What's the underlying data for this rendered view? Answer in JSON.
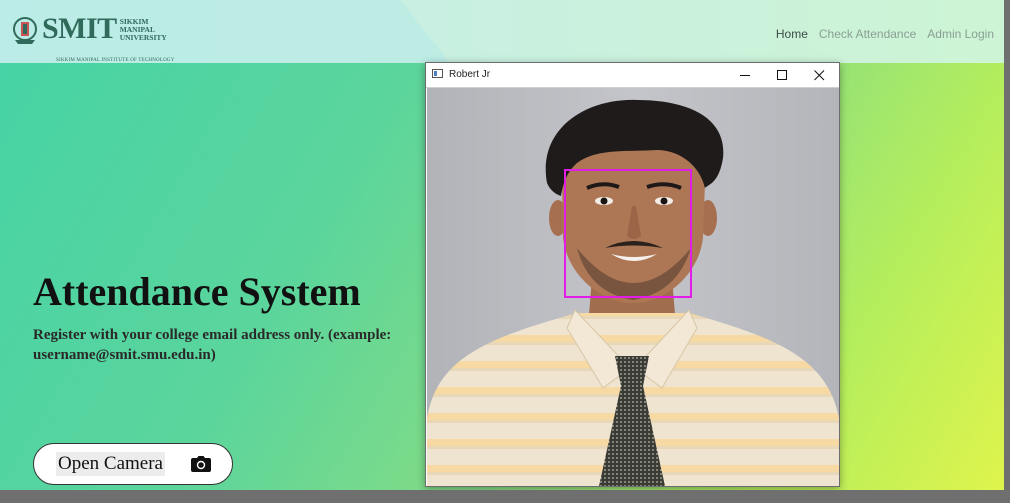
{
  "navbar": {
    "logo": {
      "word": "SMIT",
      "university_lines": [
        "SIKKIM",
        "MANIPAL",
        "UNIVERSITY"
      ],
      "institute": "SIKKIM MANIPAL INSTITUTE OF TECHNOLOGY"
    },
    "links": [
      {
        "label": "Home",
        "active": true
      },
      {
        "label": "Check Attendance",
        "active": false
      },
      {
        "label": "Admin Login",
        "active": false
      }
    ]
  },
  "hero": {
    "title": "Attendance System",
    "subtitle": "Register with your college email address only. (example: username@smit.smu.edu.in)",
    "camera_button": {
      "label": "Open Camera",
      "icon": "camera-icon"
    }
  },
  "camera_window": {
    "title": "Robert Jr",
    "controls": [
      "minimize-icon",
      "maximize-icon",
      "close-icon"
    ],
    "detection_box_color": "#e31de8"
  },
  "colors": {
    "gradient_start": "#45d3a6",
    "gradient_end": "#dff44c",
    "title": "#111111"
  }
}
